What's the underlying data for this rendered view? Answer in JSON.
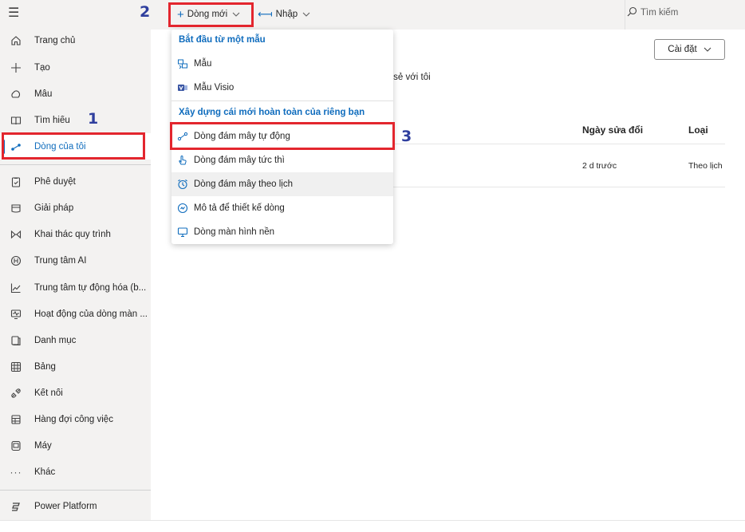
{
  "sidebar": {
    "items": [
      {
        "label": "Trang chủ",
        "icon": "home-icon"
      },
      {
        "label": "Tạo",
        "icon": "plus-icon"
      },
      {
        "label": "Mẫu",
        "icon": "templates-icon"
      },
      {
        "label": "Tìm hiểu",
        "icon": "book-icon"
      },
      {
        "label": "Dòng của tôi",
        "icon": "flow-icon"
      },
      {
        "label": "Phê duyệt",
        "icon": "clipboard-check-icon"
      },
      {
        "label": "Giải pháp",
        "icon": "solutions-icon"
      },
      {
        "label": "Khai thác quy trình",
        "icon": "process-mining-icon"
      },
      {
        "label": "Trung tâm AI",
        "icon": "ai-hub-icon"
      },
      {
        "label": "Trung tâm tự động hóa (b...",
        "icon": "chart-line-icon"
      },
      {
        "label": "Hoạt động của dòng màn ...",
        "icon": "monitor-activity-icon"
      },
      {
        "label": "Danh mục",
        "icon": "catalog-icon"
      },
      {
        "label": "Bảng",
        "icon": "table-icon"
      },
      {
        "label": "Kết nối",
        "icon": "connection-icon"
      },
      {
        "label": "Hàng đợi công việc",
        "icon": "work-queue-icon"
      },
      {
        "label": "Máy",
        "icon": "machine-icon"
      },
      {
        "label": "Khác",
        "icon": "more-icon"
      }
    ],
    "footer": {
      "label": "Power Platform",
      "icon": "power-platform-icon"
    }
  },
  "topbar": {
    "new_flow": "Dòng mới",
    "import": "Nhập",
    "search": "Tìm kiếm"
  },
  "main": {
    "settings": "Cài đặt",
    "shared_text": "ia sẻ với tôi",
    "columns": {
      "modified": "Ngày sửa đổi",
      "type": "Loại"
    },
    "row": {
      "modified": "2 d trước",
      "type": "Theo lịch"
    }
  },
  "dropdown": {
    "section1": "Bắt đầu từ một mẫu",
    "template": "Mẫu",
    "visio": "Mẫu Visio",
    "section2": "Xây dựng cái mới hoàn toàn của riêng bạn",
    "automated": "Dòng đám mây tự động",
    "instant": "Dòng đám mây tức thì",
    "scheduled": "Dòng đám mây theo lịch",
    "describe": "Mô tả để thiết kế dòng",
    "desktop": "Dòng màn hình nền"
  },
  "annotations": {
    "n1": "1",
    "n2": "2",
    "n3": "3"
  },
  "colors": {
    "accent": "#0f6cbd",
    "annotation_red": "#e3262e",
    "annotation_number": "#2f3f9e"
  }
}
